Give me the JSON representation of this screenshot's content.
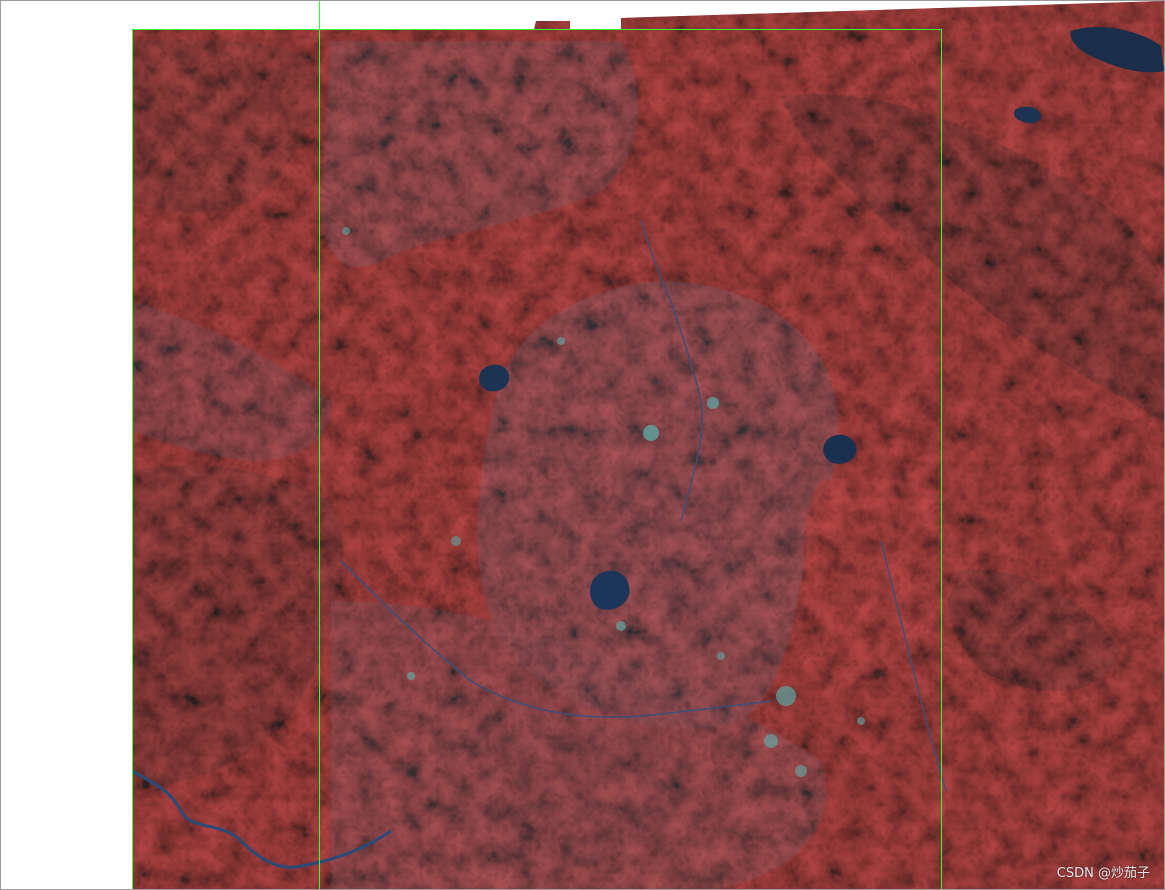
{
  "image": {
    "kind": "false-color composite satellite imagery",
    "colors": {
      "vegetation": "#8e1e1a",
      "dense_forest": "#5a1513",
      "lowland": "#6f3a44",
      "water": "#1d3558",
      "urban": "#5fa6a3",
      "frame_line": "#33ff33"
    }
  },
  "watermark": "CSDN @炒茄子"
}
